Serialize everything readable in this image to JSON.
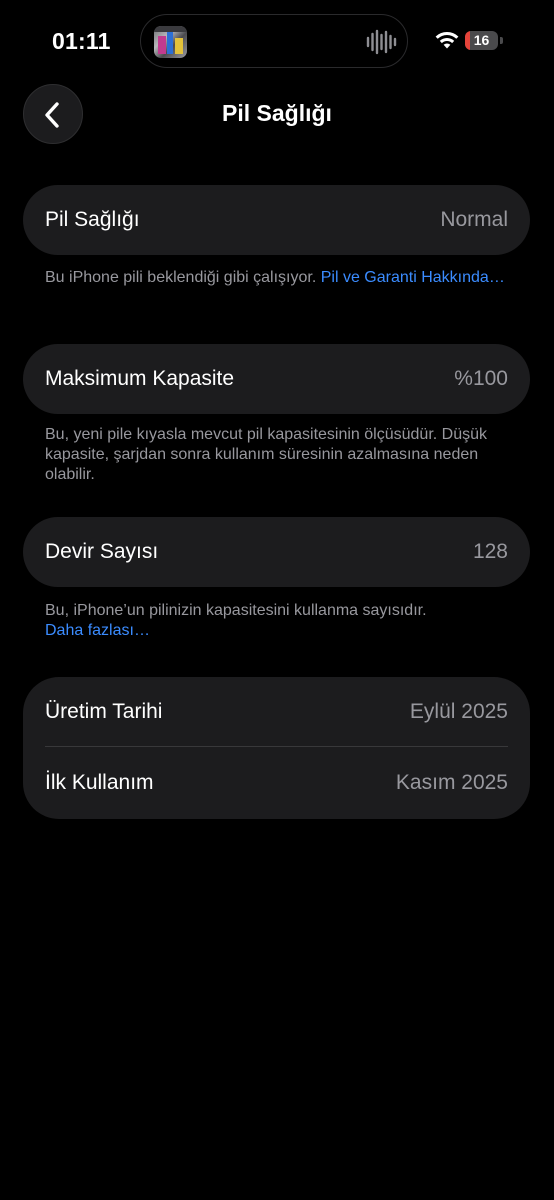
{
  "status_bar": {
    "time": "01:11",
    "battery_level": "16",
    "battery_fraction": 0.16,
    "icons": [
      "album-art-icon",
      "waveform-icon",
      "wifi-icon",
      "battery-icon"
    ]
  },
  "nav": {
    "title": "Pil Sağlığı",
    "back_icon": "chevron-left-icon"
  },
  "sections": {
    "health": {
      "label": "Pil Sağlığı",
      "value": "Normal",
      "footnote_text": "Bu iPhone pili beklendiği gibi çalışıyor.",
      "footnote_link": "Pil ve Garanti Hakkında…"
    },
    "capacity": {
      "label": "Maksimum Kapasite",
      "value": "%100",
      "footnote_text": "Bu, yeni pile kıyasla mevcut pil kapasitesinin ölçüsüdür. Düşük kapasite, şarjdan sonra kullanım süresinin azalmasına neden olabilir."
    },
    "cycles": {
      "label": "Devir Sayısı",
      "value": "128",
      "footnote_text": "Bu, iPhone’un pilinizin kapasitesini kullanma sayısıdır.",
      "footnote_link": "Daha fazlası…"
    },
    "dates": {
      "manufacture_label": "Üretim Tarihi",
      "manufacture_value": "Eylül 2025",
      "first_use_label": "İlk Kullanım",
      "first_use_value": "Kasım 2025"
    }
  },
  "colors": {
    "background": "#000000",
    "card": "#1c1c1e",
    "secondary_text": "#98989e",
    "link": "#3b8cff",
    "battery_low": "#e5433a"
  }
}
